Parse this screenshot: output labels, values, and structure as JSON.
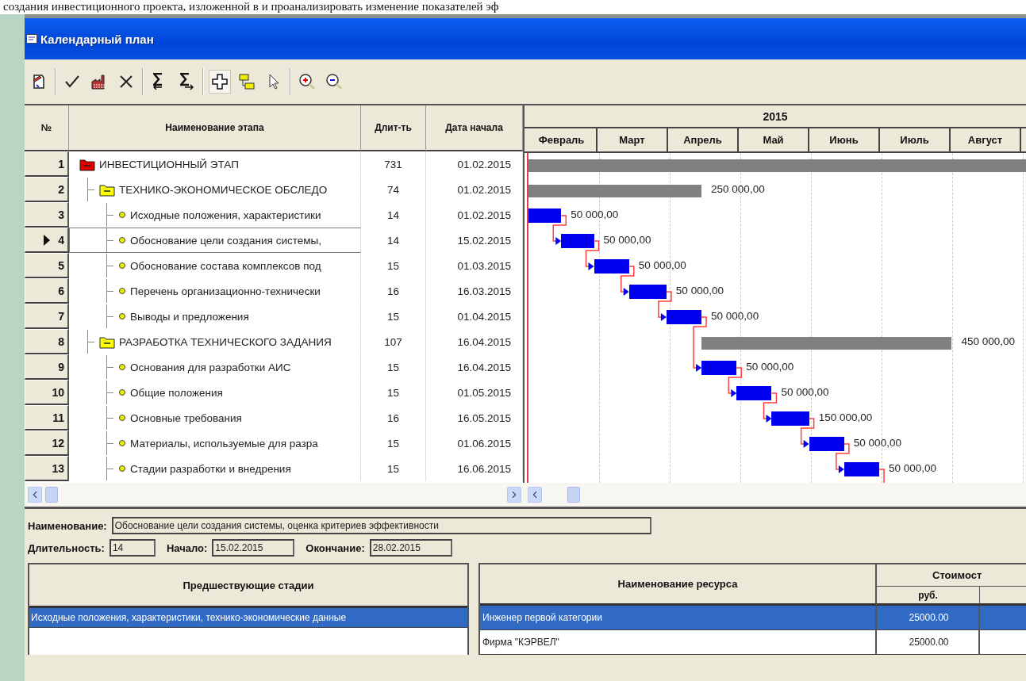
{
  "document_text": "создания инвестиционного проекта, изложенной в   и проанализировать изменение показателей эф",
  "window": {
    "title": "Календарный план"
  },
  "toolbar": [
    [
      {
        "kind": "edit",
        "pressed": false
      }
    ],
    [
      {
        "kind": "check",
        "pressed": false
      },
      {
        "kind": "factory",
        "pressed": false
      },
      {
        "kind": "cross",
        "pressed": false
      }
    ],
    [
      {
        "kind": "sum-left",
        "pressed": false
      },
      {
        "kind": "sum-right",
        "pressed": false
      }
    ],
    [
      {
        "kind": "plus",
        "pressed": true
      },
      {
        "kind": "link",
        "pressed": false
      },
      {
        "kind": "pointer",
        "pressed": false
      }
    ],
    [
      {
        "kind": "zoom-in",
        "pressed": false
      },
      {
        "kind": "zoom-out",
        "pressed": false
      }
    ]
  ],
  "schedule": {
    "columns": [
      "№",
      "Наименование этапа",
      "Длит-ть",
      "Дата начала"
    ],
    "rows": [
      {
        "number": "1",
        "name": "ИНВЕСТИЦИОННЫЙ ЭТАП",
        "kind": "phase",
        "expanded": true,
        "duration": "731",
        "start": "01.02.2015",
        "selected": false,
        "children": [
          {
            "number": "2",
            "name": "ТЕХНИКО-ЭКОНОМИЧЕСКОЕ ОБСЛЕДО",
            "kind": "group",
            "expanded": true,
            "duration": "74",
            "start": "01.02.2015",
            "selected": false,
            "cost": "250 000,00",
            "children": [
              {
                "number": "3",
                "name": "Исходные положения, характеристики",
                "kind": "task",
                "duration": "14",
                "start": "01.02.2015",
                "selected": false,
                "cost": "50 000,00"
              },
              {
                "number": "4",
                "name": "Обоснование цели создания системы,",
                "kind": "task",
                "duration": "14",
                "start": "15.02.2015",
                "selected": true,
                "cost": "50 000,00"
              },
              {
                "number": "5",
                "name": "Обоснование состава комплексов под",
                "kind": "task",
                "duration": "15",
                "start": "01.03.2015",
                "selected": false,
                "cost": "50 000,00"
              },
              {
                "number": "6",
                "name": "Перечень организационно-технически",
                "kind": "task",
                "duration": "16",
                "start": "16.03.2015",
                "selected": false,
                "cost": "50 000,00"
              },
              {
                "number": "7",
                "name": "Выводы и предложения",
                "kind": "task",
                "duration": "15",
                "start": "01.04.2015",
                "selected": false,
                "cost": "50 000,00"
              }
            ]
          },
          {
            "number": "8",
            "name": "РАЗРАБОТКА ТЕХНИЧЕСКОГО ЗАДАНИЯ",
            "kind": "group",
            "expanded": true,
            "duration": "107",
            "start": "16.04.2015",
            "selected": false,
            "cost": "450 000,00",
            "children": [
              {
                "number": "9",
                "name": "Основания для разработки АИС",
                "kind": "task",
                "duration": "15",
                "start": "16.04.2015",
                "selected": false,
                "cost": "50 000,00"
              },
              {
                "number": "10",
                "name": "Общие положения",
                "kind": "task",
                "duration": "15",
                "start": "01.05.2015",
                "selected": false,
                "cost": "50 000,00"
              },
              {
                "number": "11",
                "name": "Основные требования",
                "kind": "task",
                "duration": "16",
                "start": "16.05.2015",
                "selected": false,
                "cost": "150 000,00"
              },
              {
                "number": "12",
                "name": "Материалы, используемые для разра",
                "kind": "task",
                "duration": "15",
                "start": "01.06.2015",
                "selected": false,
                "cost": "50 000,00"
              },
              {
                "number": "13",
                "name": "Стадии разработки и внедрения",
                "kind": "task",
                "duration": "15",
                "start": "16.06.2015",
                "selected": false,
                "cost": "50 000,00"
              }
            ]
          }
        ]
      }
    ]
  },
  "gantt": {
    "year": "2015",
    "months": [
      "Февраль",
      "Март",
      "Апрель",
      "Май",
      "Июнь",
      "Июль",
      "Август"
    ]
  },
  "details": {
    "name_label": "Наименование:",
    "name_value": "Обоснование цели создания системы, оценка критериев эффективности",
    "duration_label": "Длительность:",
    "duration_value": "14",
    "start_label": "Начало:",
    "start_value": "15.02.2015",
    "end_label": "Окончание:",
    "end_value": "28.02.2015"
  },
  "predecessors": {
    "header": "Предшествующие стадии",
    "rows": [
      {
        "name": "Исходные положения, характеристики, технико-экономические данные",
        "selected": true
      }
    ]
  },
  "resources": {
    "header": "Наименование ресурса",
    "cost_header": "Стоимост",
    "currency_header": "руб.",
    "rows": [
      {
        "name": "Инженер первой категории",
        "cost": "25000.00",
        "selected": true
      },
      {
        "name": "Фирма \"КЭРВЕЛ\"",
        "cost": "25000.00",
        "selected": false
      }
    ]
  }
}
